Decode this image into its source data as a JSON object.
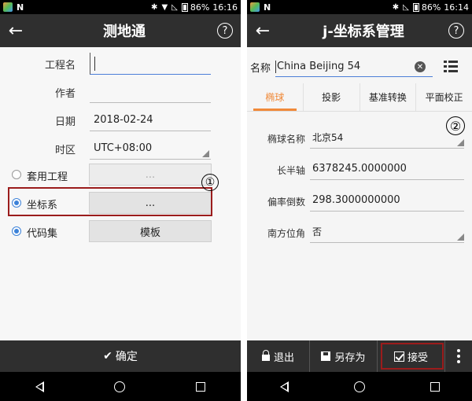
{
  "left": {
    "status": {
      "battery": "86%",
      "time": "16:16"
    },
    "title": "测地通",
    "help_symbol": "?",
    "back_symbol": "←",
    "fields": [
      {
        "label": "工程名",
        "value": ""
      },
      {
        "label": "作者",
        "value": ""
      },
      {
        "label": "日期",
        "value": "2018-02-24"
      },
      {
        "label": "时区",
        "value": "UTC+08:00"
      }
    ],
    "options": [
      {
        "label": "套用工程",
        "button": "...",
        "checked": false
      },
      {
        "label": "坐标系",
        "button": "...",
        "checked": true
      },
      {
        "label": "代码集",
        "button": "模板",
        "checked": true
      }
    ],
    "annotation": "①",
    "confirm": "确定"
  },
  "right": {
    "status": {
      "battery": "86%",
      "time": "16:14"
    },
    "title": "j-坐标系管理",
    "help_symbol": "?",
    "back_symbol": "←",
    "name_label": "名称",
    "name_value": "China Beijing 54",
    "tabs": [
      "椭球",
      "投影",
      "基准转换",
      "平面校正"
    ],
    "active_tab": 0,
    "annotation": "②",
    "params": [
      {
        "label": "椭球名称",
        "value": "北京54"
      },
      {
        "label": "长半轴",
        "value": "6378245.0000000"
      },
      {
        "label": "偏率倒数",
        "value": "298.3000000000"
      },
      {
        "label": "南方位角",
        "value": "否"
      }
    ],
    "actions": {
      "exit": "退出",
      "save_as": "另存为",
      "accept": "接受"
    }
  },
  "colors": {
    "titlebar": "#2f2f2f",
    "accent_tab": "#f08a3a",
    "radio": "#3c82d8",
    "highlight_box": "#9b1c1c"
  }
}
